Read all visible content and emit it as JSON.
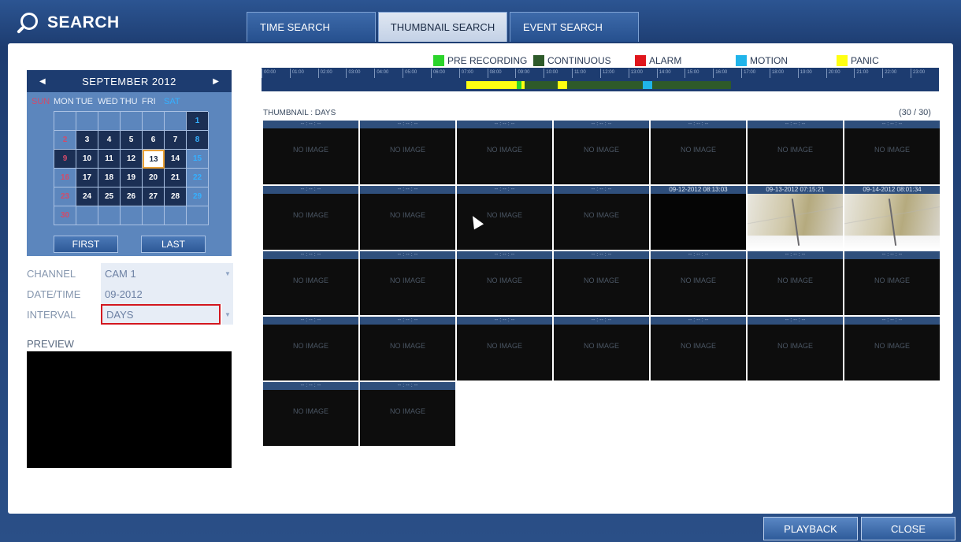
{
  "header": {
    "title": "SEARCH",
    "icon": "search-icon"
  },
  "tabs": [
    {
      "label": "TIME SEARCH",
      "active": false
    },
    {
      "label": "THUMBNAIL SEARCH",
      "active": true
    },
    {
      "label": "EVENT SEARCH",
      "active": false
    }
  ],
  "calendar": {
    "month": "SEPTEMBER 2012",
    "weekdays": [
      "SUN",
      "MON",
      "TUE",
      "WED",
      "THU",
      "FRI",
      "SAT"
    ],
    "first_label": "FIRST",
    "last_label": "LAST",
    "selected_day": "13",
    "cells": [
      "",
      "",
      "",
      "",
      "",
      "",
      "1",
      "2",
      "3",
      "4",
      "5",
      "6",
      "7",
      "8",
      "9",
      "10",
      "11",
      "12",
      "13",
      "14",
      "15",
      "16",
      "17",
      "18",
      "19",
      "20",
      "21",
      "22",
      "23",
      "24",
      "25",
      "26",
      "27",
      "28",
      "29",
      "30",
      "",
      "",
      "",
      "",
      "",
      ""
    ]
  },
  "fields": {
    "channel_label": "CHANNEL",
    "channel_value": "CAM 1",
    "datetime_label": "DATE/TIME",
    "datetime_value": "09-2012",
    "interval_label": "INTERVAL",
    "interval_value": "DAYS"
  },
  "preview_label": "PREVIEW",
  "legend": [
    {
      "label": "PRE RECORDING",
      "color": "#2bd42b"
    },
    {
      "label": "CONTINUOUS",
      "color": "#2e5a2a"
    },
    {
      "label": "ALARM",
      "color": "#e0161c"
    },
    {
      "label": "MOTION",
      "color": "#20b4ea"
    },
    {
      "label": "PANIC",
      "color": "#ffff12"
    }
  ],
  "timeline_labels": [
    "00:00",
    "01:00",
    "02:00",
    "03:00",
    "04:00",
    "05:00",
    "06:00",
    "07:00",
    "08:00",
    "09:00",
    "10:00",
    "11:00",
    "12:00",
    "13:00",
    "14:00",
    "15:00",
    "16:00",
    "17:00",
    "18:00",
    "19:00",
    "20:00",
    "21:00",
    "22:00",
    "23:00"
  ],
  "thumbnail": {
    "title": "THUMBNAIL : DAYS",
    "count": "(30 / 30)",
    "empty_header": "-- / -- / --",
    "no_image": "NO IMAGE"
  },
  "thumbs": [
    {
      "header": "-- : -- : --",
      "type": "empty"
    },
    {
      "header": "-- : -- : --",
      "type": "empty"
    },
    {
      "header": "-- : -- : --",
      "type": "empty"
    },
    {
      "header": "-- : -- : --",
      "type": "empty"
    },
    {
      "header": "-- : -- : --",
      "type": "empty"
    },
    {
      "header": "-- : -- : --",
      "type": "empty"
    },
    {
      "header": "-- : -- : --",
      "type": "empty"
    },
    {
      "header": "-- : -- : --",
      "type": "empty"
    },
    {
      "header": "-- : -- : --",
      "type": "empty"
    },
    {
      "header": "-- : -- : --",
      "type": "empty"
    },
    {
      "header": "-- : -- : --",
      "type": "empty"
    },
    {
      "header": "09-12-2012 08:13:03",
      "type": "dark"
    },
    {
      "header": "09-13-2012 07:15:21",
      "type": "image"
    },
    {
      "header": "09-14-2012 08:01:34",
      "type": "image"
    },
    {
      "header": "-- : -- : --",
      "type": "empty"
    },
    {
      "header": "-- : -- : --",
      "type": "empty"
    },
    {
      "header": "-- : -- : --",
      "type": "empty"
    },
    {
      "header": "-- : -- : --",
      "type": "empty"
    },
    {
      "header": "-- : -- : --",
      "type": "empty"
    },
    {
      "header": "-- : -- : --",
      "type": "empty"
    },
    {
      "header": "-- : -- : --",
      "type": "empty"
    },
    {
      "header": "-- : -- : --",
      "type": "empty"
    },
    {
      "header": "-- : -- : --",
      "type": "empty"
    },
    {
      "header": "-- : -- : --",
      "type": "empty"
    },
    {
      "header": "-- : -- : --",
      "type": "empty"
    },
    {
      "header": "-- : -- : --",
      "type": "empty"
    },
    {
      "header": "-- : -- : --",
      "type": "empty"
    },
    {
      "header": "-- : -- : --",
      "type": "empty"
    },
    {
      "header": "-- : -- : --",
      "type": "empty"
    },
    {
      "header": "-- : -- : --",
      "type": "empty"
    }
  ],
  "buttons": {
    "playback": "PLAYBACK",
    "close": "CLOSE"
  }
}
